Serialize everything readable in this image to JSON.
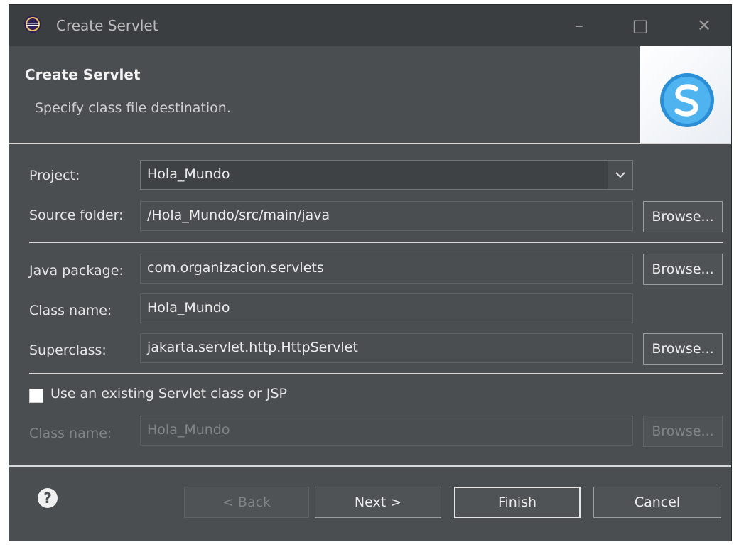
{
  "window": {
    "title": "Create Servlet",
    "controls": {
      "minimize": "–",
      "maximize": "□",
      "close": "✕"
    }
  },
  "header": {
    "title": "Create Servlet",
    "description": "Specify class file destination."
  },
  "form": {
    "project": {
      "label": "Project:",
      "value": "Hola_Mundo"
    },
    "source_folder": {
      "label": "Source folder:",
      "value": "/Hola_Mundo/src/main/java",
      "browse": "Browse..."
    },
    "java_package": {
      "label": "Java package:",
      "value": "com.organizacion.servlets",
      "browse": "Browse..."
    },
    "class_name": {
      "label": "Class name:",
      "value": "Hola_Mundo"
    },
    "superclass": {
      "label": "Superclass:",
      "value": "jakarta.servlet.http.HttpServlet",
      "browse": "Browse..."
    },
    "existing": {
      "label": "Use an existing Servlet class or JSP",
      "checked": false
    },
    "existing_class_name": {
      "label": "Class name:",
      "value": "Hola_Mundo",
      "browse": "Browse..."
    }
  },
  "footer": {
    "help": "?",
    "back": "< Back",
    "next": "Next >",
    "finish": "Finish",
    "cancel": "Cancel"
  }
}
